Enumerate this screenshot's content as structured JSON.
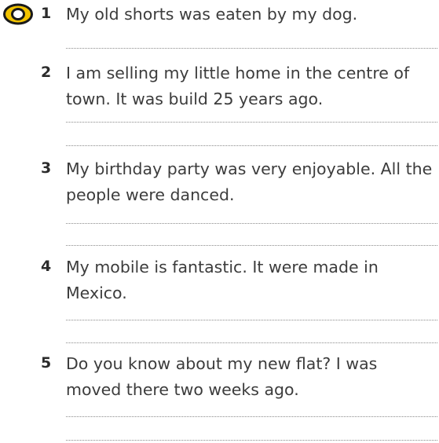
{
  "items": [
    {
      "number": "1",
      "sentence": "My old shorts was eaten by my dog."
    },
    {
      "number": "2",
      "sentence": "I am selling my little home in the centre of town. It was build 25 years ago."
    },
    {
      "number": "3",
      "sentence": "My birthday party was very enjoyable. All the people were danced."
    },
    {
      "number": "4",
      "sentence": "My mobile is fantastic. It were made in Mexico."
    },
    {
      "number": "5",
      "sentence": "Do you know about my new flat? I was moved there two weeks ago."
    }
  ],
  "icon": {
    "name": "example-icon",
    "fill": "#f2c300",
    "ring": "#1e1e1e"
  }
}
